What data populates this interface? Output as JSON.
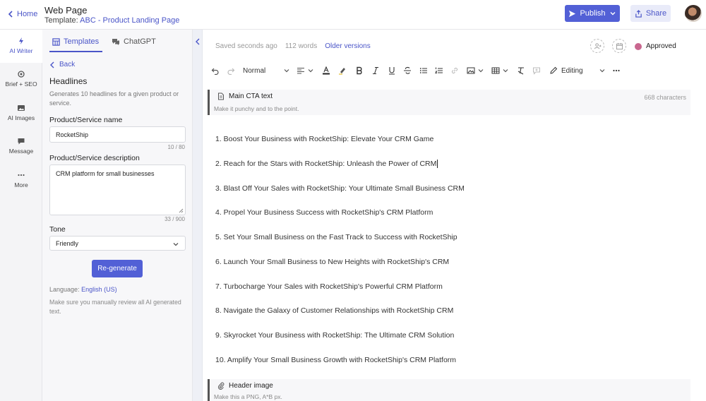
{
  "header": {
    "home_label": "Home",
    "doc_title": "Web Page",
    "template_prefix": "Template:",
    "template_name": "ABC - Product Landing Page",
    "publish_label": "Publish",
    "share_label": "Share"
  },
  "rail": {
    "items": [
      {
        "label": "AI Writer",
        "icon": "lightning-icon"
      },
      {
        "label": "Brief + SEO",
        "icon": "target-icon"
      },
      {
        "label": "AI Images",
        "icon": "image-icon"
      },
      {
        "label": "Message",
        "icon": "chat-icon"
      },
      {
        "label": "More",
        "icon": "more-icon"
      }
    ]
  },
  "panel": {
    "tabs": [
      {
        "label": "Templates",
        "icon": "grid-icon"
      },
      {
        "label": "ChatGPT",
        "icon": "chatgpt-icon"
      }
    ],
    "back_label": "Back",
    "title": "Headlines",
    "description": "Generates 10 headlines for a given product or service.",
    "name_label": "Product/Service name",
    "name_value": "RocketShip",
    "name_counter": "10 / 80",
    "desc_label": "Product/Service description",
    "desc_value": "CRM platform for small businesses",
    "desc_counter": "33 / 900",
    "tone_label": "Tone",
    "tone_value": "Friendly",
    "regen_label": "Re-generate",
    "language_prefix": "Language:",
    "language_value": "English (US)",
    "note": "Make sure you manually review all AI generated text."
  },
  "editor": {
    "saved": "Saved seconds ago",
    "words": "112 words",
    "older_versions": "Older versions",
    "status": "Approved",
    "toolbar": {
      "style": "Normal",
      "mode": "Editing"
    },
    "cta": {
      "title": "Main CTA text",
      "subtitle": "Make it punchy and to the point.",
      "count": "668 characters"
    },
    "headlines": [
      "1. Boost Your Business with RocketShip: Elevate Your CRM Game",
      "2. Reach for the Stars with RocketShip: Unleash the Power of CRM",
      "3. Blast Off Your Sales with RocketShip: Your Ultimate Small Business CRM",
      "4. Propel Your Business Success with RocketShip's CRM Platform",
      "5. Set Your Small Business on the Fast Track to Success with RocketShip",
      "6. Launch Your Small Business to New Heights with RocketShip's CRM",
      "7. Turbocharge Your Sales with RocketShip's Powerful CRM Platform",
      "8. Navigate the Galaxy of Customer Relationships with RocketShip CRM",
      "9. Skyrocket Your Business with RocketShip: The Ultimate CRM Solution",
      "10. Amplify Your Small Business Growth with RocketShip's CRM Platform"
    ],
    "image_block": {
      "title": "Header image",
      "subtitle": "Make this a PNG, A*B px."
    }
  },
  "colors": {
    "accent": "#5260d6",
    "status_dot": "#c9678f"
  }
}
